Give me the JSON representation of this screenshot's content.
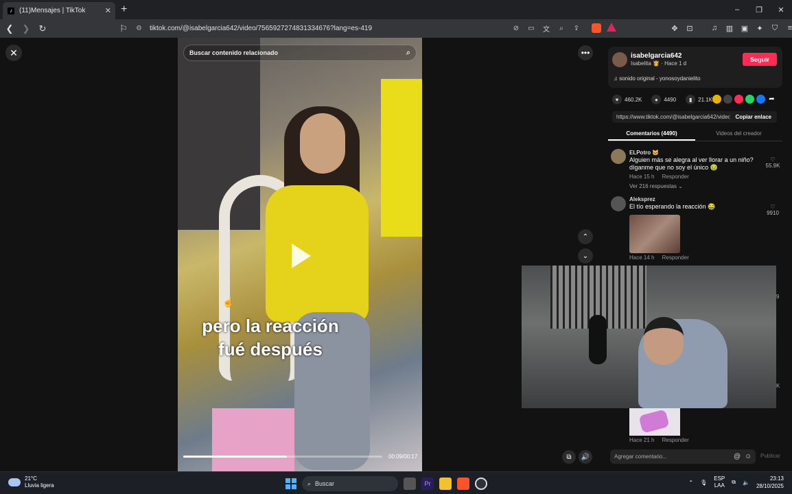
{
  "browser": {
    "tab_title": "(11)Mensajes | TikTok",
    "tab_favicon": "tiktok-icon",
    "new_tab_symbol": "+",
    "url": "tiktok.com/@isabelgarcia642/video/7565927274831334676?lang=es-419",
    "window_controls": [
      "–",
      "❐",
      "✕"
    ]
  },
  "video": {
    "search_placeholder": "Buscar contenido relacionado",
    "caption_line1": "pero la reacción",
    "caption_line2": "fué después",
    "time": "00:09/00:17",
    "progress": 0.52
  },
  "creator": {
    "username": "isabelgarcia642",
    "subtitle": "Isabelita 👸 · Hace 1 d",
    "follow_label": "Seguir",
    "sound": "♫  sonido original - yonosoydanielito"
  },
  "stats": {
    "likes": "460.2K",
    "comments": "4490",
    "saves": "21.1K"
  },
  "link": {
    "url": "https://www.tiktok.com/@isabelgarcia642/video/...",
    "copy_label": "Copiar enlace"
  },
  "tabs": {
    "comments": "Comentarios (4490)",
    "creator_videos": "Videos del creador"
  },
  "comments": [
    {
      "author": "ELPotro 🐱",
      "text": "Alguien más se alegra al ver llorar a un niño? díganme que no soy el único 🤢",
      "time": "Hace 15 h",
      "reply": "Responder",
      "likes": "55.9K",
      "replies_label": "Ver 216 respuestas ⌄"
    },
    {
      "author": "Aleksprez",
      "text": "El tío esperando la reacción 😂",
      "time": "Hace 14 h",
      "reply": "Responder",
      "likes": "9910"
    },
    {
      "time": "Hace 21 h",
      "reply": "Responder"
    }
  ],
  "partial_edge": {
    "a": "9",
    "b": "K"
  },
  "comment_input": {
    "placeholder": "Agregar comentario...",
    "publish_label": "Publicar"
  },
  "taskbar": {
    "temperature": "21°C",
    "weather": "Lluvia ligera",
    "search_label": "Buscar",
    "lang_top": "ESP",
    "lang_bottom": "LAA",
    "time": "23:13",
    "date": "28/10/2025"
  },
  "colors": {
    "accent": "#fe2c55",
    "page_bg": "#121212",
    "browser_bar": "#35363a"
  }
}
